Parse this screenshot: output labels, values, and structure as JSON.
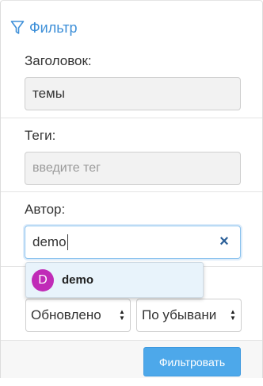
{
  "filter": {
    "title": "Фильтр",
    "icon": "filter-funnel-icon",
    "accent_color": "#3d8fd8"
  },
  "title_field": {
    "label": "Заголовок:",
    "value": "темы"
  },
  "tags_field": {
    "label": "Теги:",
    "placeholder": "введите тег"
  },
  "author_field": {
    "label": "Автор:",
    "value": "demo",
    "clear_icon": "close-icon",
    "suggestions": [
      {
        "initial": "D",
        "name": "demo",
        "avatar_color": "#c02bb7"
      }
    ]
  },
  "sort": {
    "field_value": "Обновлено",
    "order_value": "По убывани"
  },
  "submit_button": {
    "label": "Фильтровать",
    "color": "#4da8ea"
  }
}
